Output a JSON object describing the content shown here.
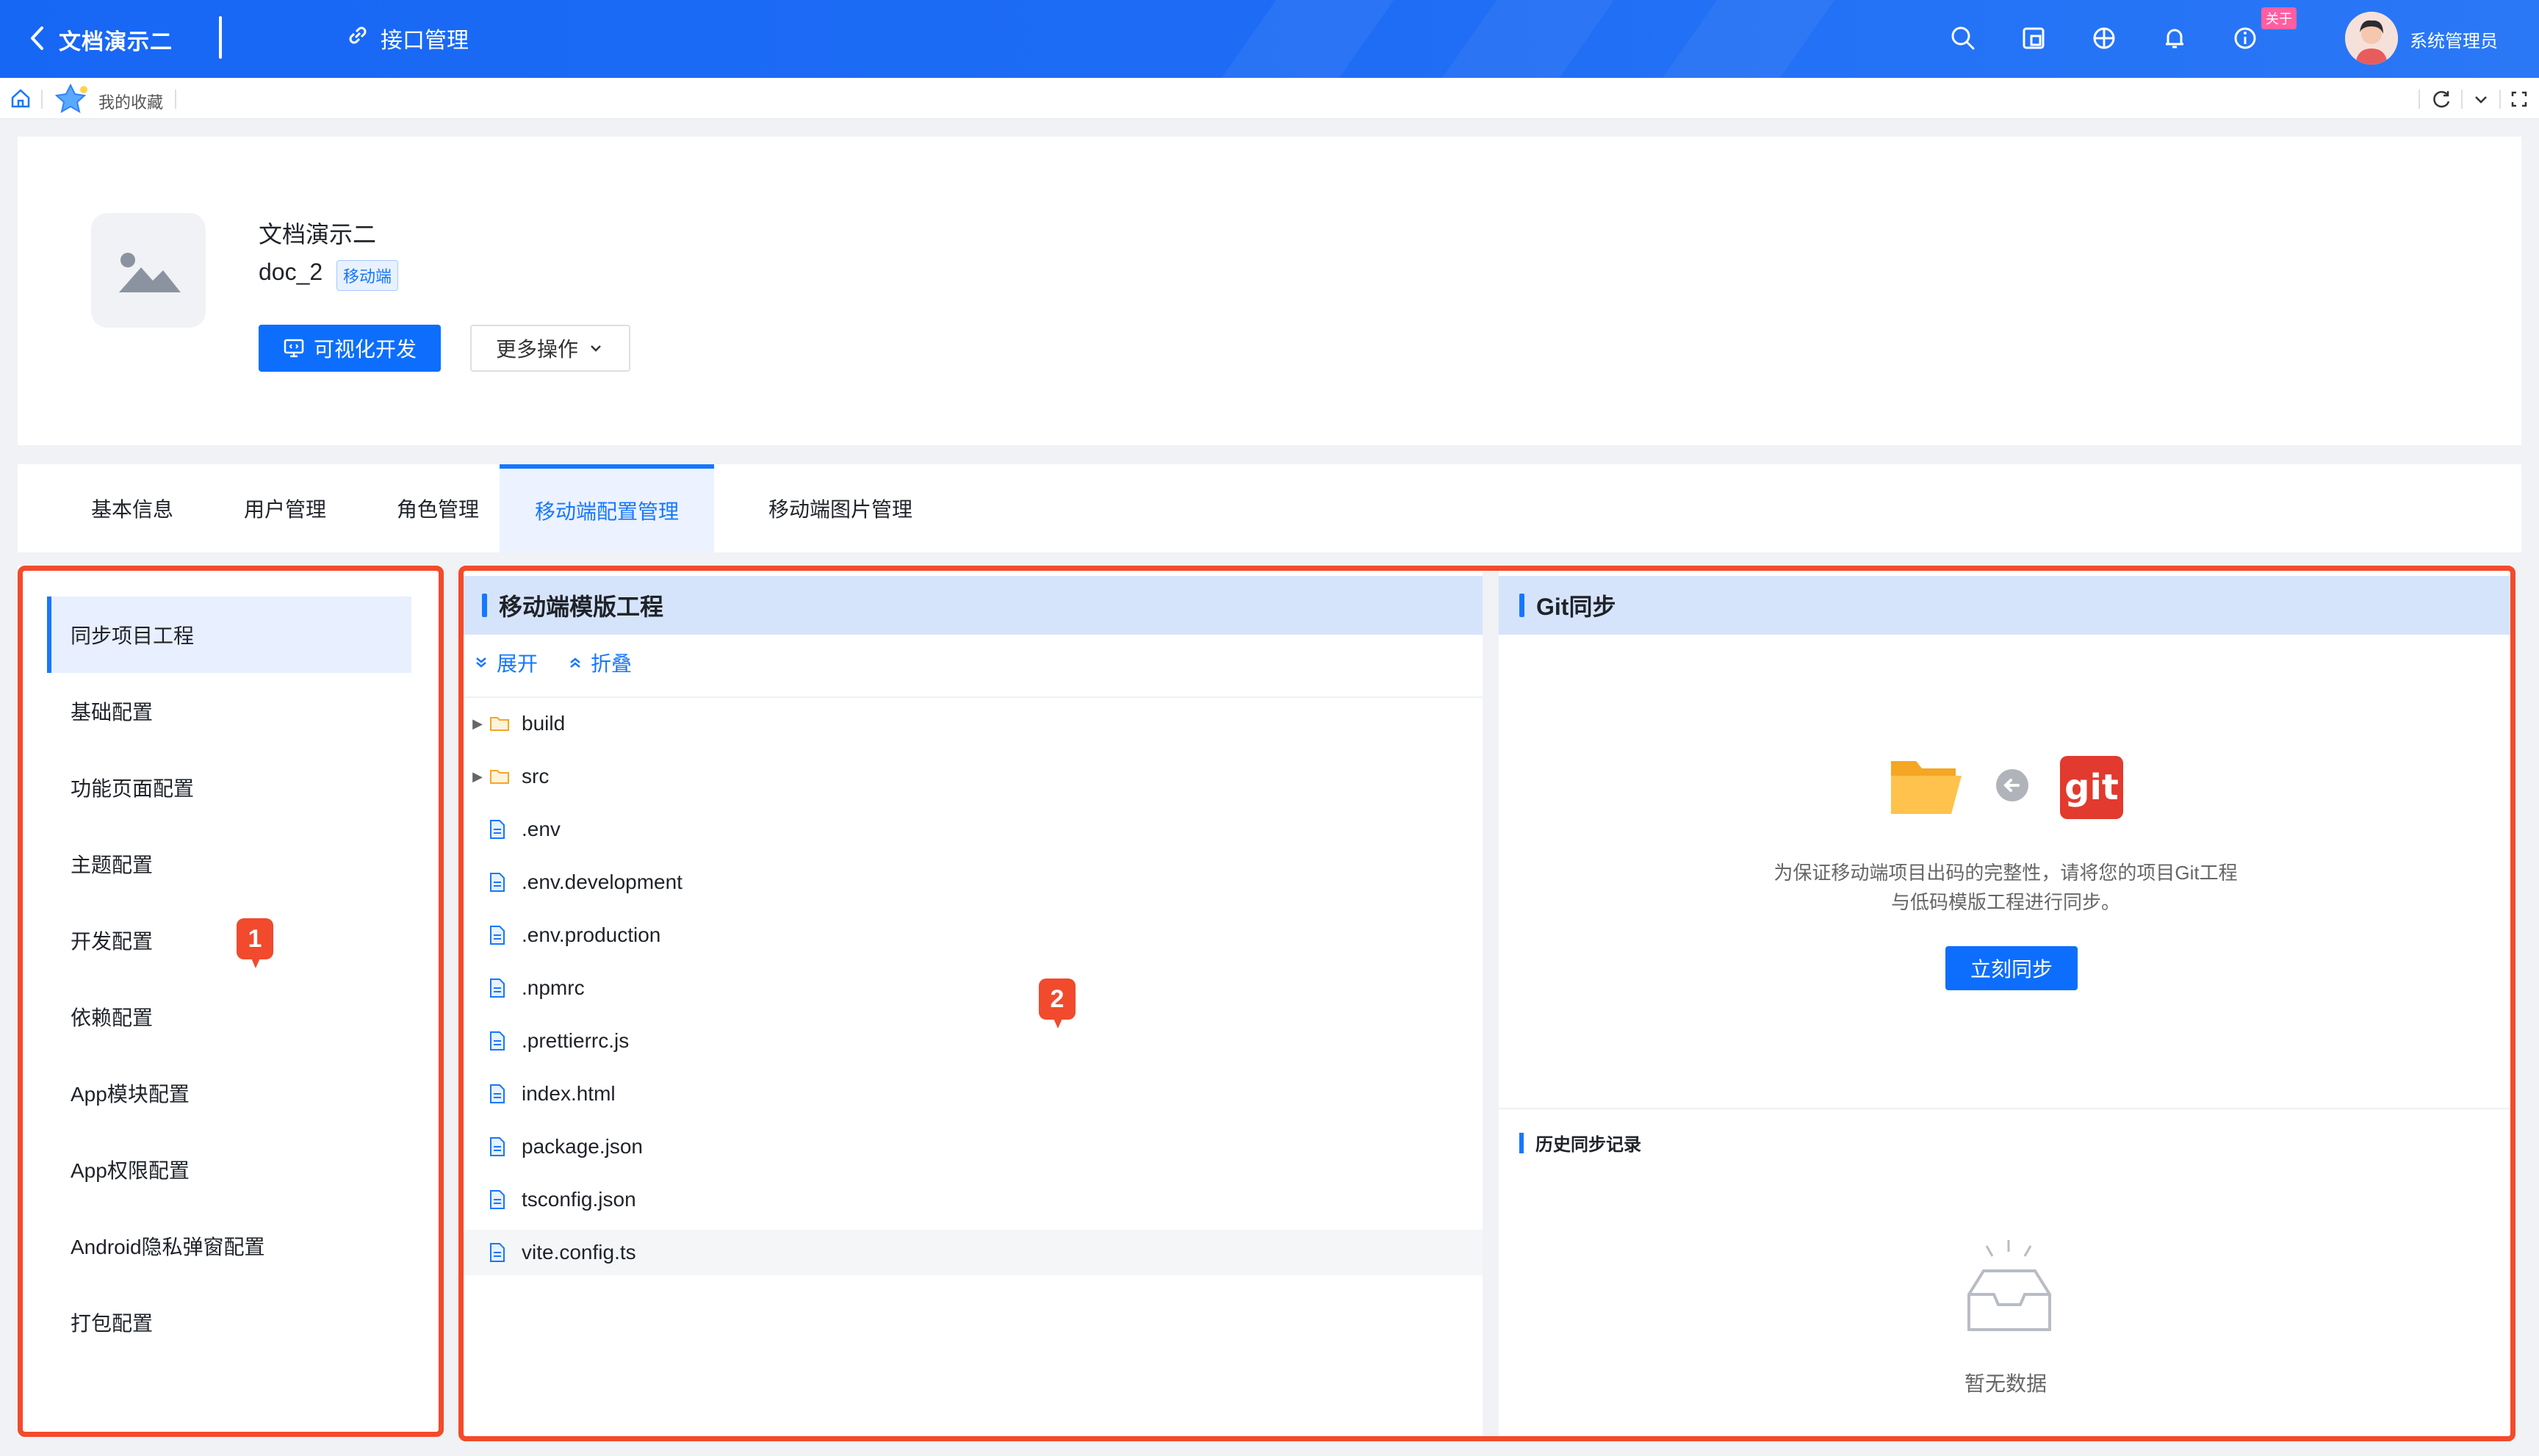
{
  "topbar": {
    "app_title": "文档演示二",
    "api_management": "接口管理",
    "new_badge": "关于",
    "user_name": "系统管理员"
  },
  "subbar": {
    "favorites": "我的收藏"
  },
  "project": {
    "name": "文档演示二",
    "code": "doc_2",
    "tag": "移动端",
    "visual_dev_label": "可视化开发",
    "more_actions_label": "更多操作"
  },
  "tabs": [
    {
      "label": "基本信息"
    },
    {
      "label": "用户管理"
    },
    {
      "label": "角色管理"
    },
    {
      "label": "移动端配置管理"
    },
    {
      "label": "移动端图片管理"
    }
  ],
  "menu": [
    {
      "label": "同步项目工程"
    },
    {
      "label": "基础配置"
    },
    {
      "label": "功能页面配置"
    },
    {
      "label": "主题配置"
    },
    {
      "label": "开发配置"
    },
    {
      "label": "依赖配置"
    },
    {
      "label": "App模块配置"
    },
    {
      "label": "App权限配置"
    },
    {
      "label": "Android隐私弹窗配置"
    },
    {
      "label": "打包配置"
    }
  ],
  "template_panel": {
    "title": "移动端模版工程",
    "expand_label": "展开",
    "collapse_label": "折叠",
    "files": [
      {
        "name": "build",
        "type": "folder"
      },
      {
        "name": "src",
        "type": "folder"
      },
      {
        "name": ".env",
        "type": "file"
      },
      {
        "name": ".env.development",
        "type": "file"
      },
      {
        "name": ".env.production",
        "type": "file"
      },
      {
        "name": ".npmrc",
        "type": "file"
      },
      {
        "name": ".prettierrc.js",
        "type": "file"
      },
      {
        "name": "index.html",
        "type": "file"
      },
      {
        "name": "package.json",
        "type": "file"
      },
      {
        "name": "tsconfig.json",
        "type": "file"
      },
      {
        "name": "vite.config.ts",
        "type": "file"
      }
    ]
  },
  "git_panel": {
    "title": "Git同步",
    "git_logo_text": "git",
    "description_line1": "为保证移动端项目出码的完整性，请将您的项目Git工程",
    "description_line2": "与低码模版工程进行同步。",
    "sync_now_label": "立刻同步",
    "history_title": "历史同步记录",
    "empty_text": "暂无数据"
  },
  "markers": {
    "m1": "1",
    "m2": "2"
  },
  "colors": {
    "primary": "#1677ff",
    "topbar": "#1f6df5",
    "highlight_border": "#f44a2b",
    "git_red": "#e23a2e",
    "folder_orange": "#f5a623"
  }
}
